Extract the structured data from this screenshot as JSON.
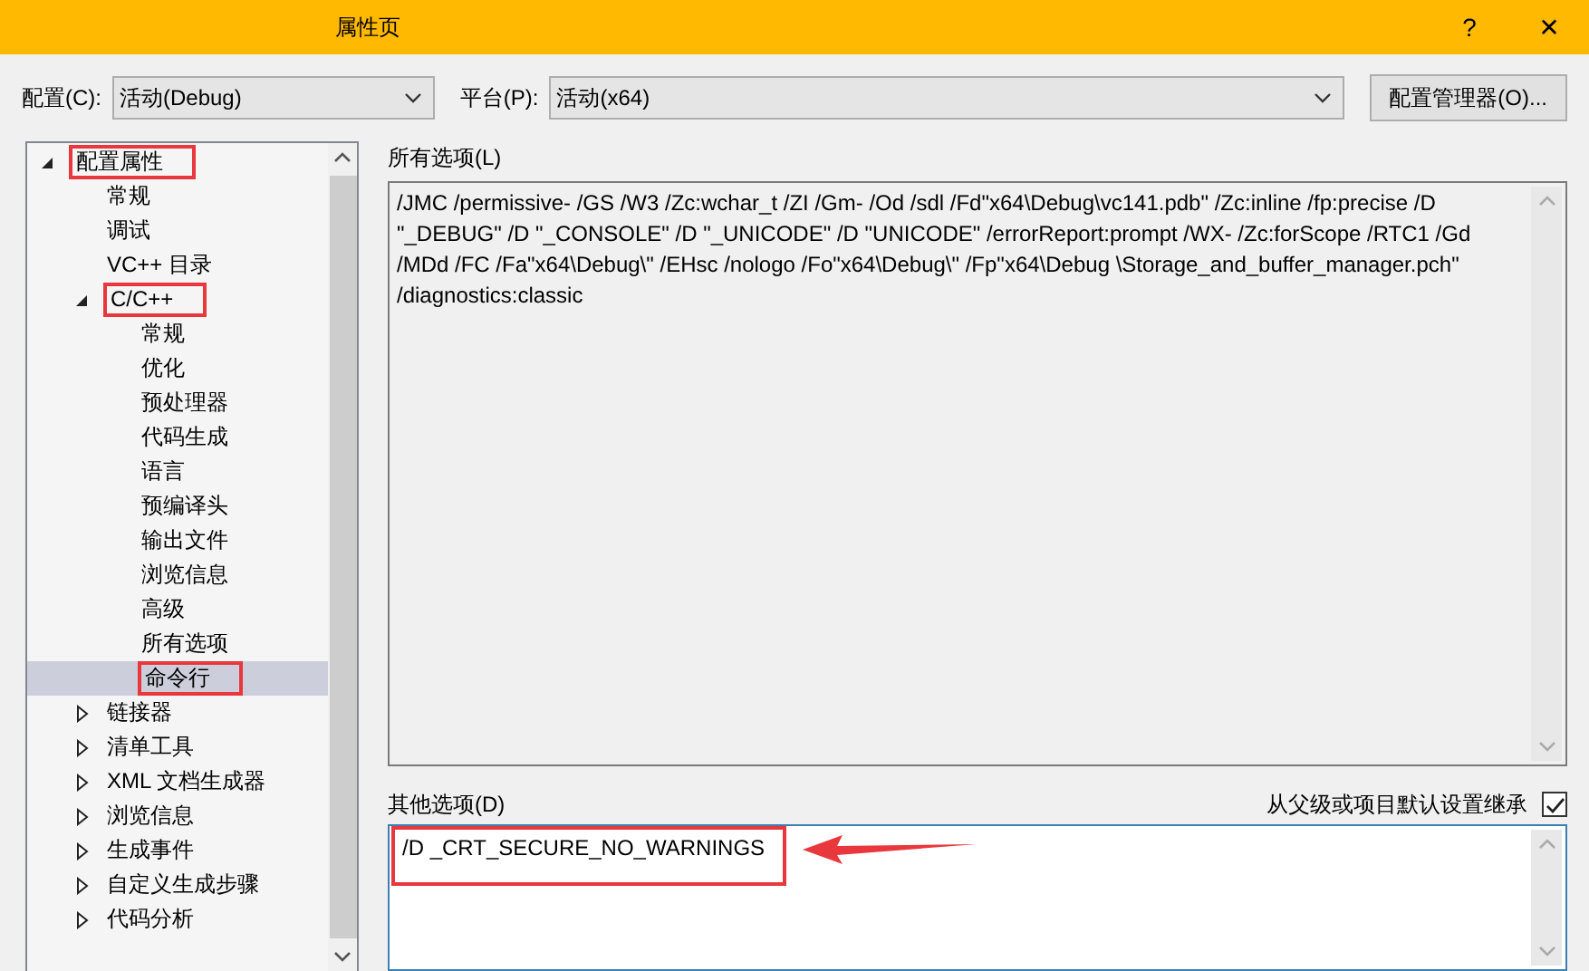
{
  "window": {
    "title": "属性页",
    "help": "?",
    "close": "✕"
  },
  "toolbar": {
    "config_label": "配置(C):",
    "config_value": "活动(Debug)",
    "platform_label": "平台(P):",
    "platform_value": "活动(x64)",
    "manager_button": "配置管理器(O)..."
  },
  "tree": [
    {
      "label": "配置属性",
      "expanded": true,
      "annotated": true,
      "selected": false,
      "children": [
        {
          "label": "常规",
          "selected": false,
          "annotated": false
        },
        {
          "label": "调试",
          "selected": false,
          "annotated": false
        },
        {
          "label": "VC++ 目录",
          "selected": false,
          "annotated": false
        },
        {
          "label": "C/C++",
          "expanded": true,
          "annotated": true,
          "selected": false,
          "children": [
            {
              "label": "常规",
              "selected": false,
              "annotated": false
            },
            {
              "label": "优化",
              "selected": false,
              "annotated": false
            },
            {
              "label": "预处理器",
              "selected": false,
              "annotated": false
            },
            {
              "label": "代码生成",
              "selected": false,
              "annotated": false
            },
            {
              "label": "语言",
              "selected": false,
              "annotated": false
            },
            {
              "label": "预编译头",
              "selected": false,
              "annotated": false
            },
            {
              "label": "输出文件",
              "selected": false,
              "annotated": false
            },
            {
              "label": "浏览信息",
              "selected": false,
              "annotated": false
            },
            {
              "label": "高级",
              "selected": false,
              "annotated": false
            },
            {
              "label": "所有选项",
              "selected": false,
              "annotated": false
            },
            {
              "label": "命令行",
              "selected": true,
              "annotated": true
            }
          ]
        },
        {
          "label": "链接器",
          "expanded": false,
          "selected": false,
          "annotated": false
        },
        {
          "label": "清单工具",
          "expanded": false,
          "selected": false,
          "annotated": false
        },
        {
          "label": "XML 文档生成器",
          "expanded": false,
          "selected": false,
          "annotated": false
        },
        {
          "label": "浏览信息",
          "expanded": false,
          "selected": false,
          "annotated": false
        },
        {
          "label": "生成事件",
          "expanded": false,
          "selected": false,
          "annotated": false
        },
        {
          "label": "自定义生成步骤",
          "expanded": false,
          "selected": false,
          "annotated": false
        },
        {
          "label": "代码分析",
          "expanded": false,
          "selected": false,
          "annotated": false
        }
      ]
    }
  ],
  "all_options": {
    "label": "所有选项(L)",
    "text": "/JMC /permissive- /GS /W3 /Zc:wchar_t /ZI /Gm- /Od /sdl /Fd\"x64\\Debug\\vc141.pdb\" /Zc:inline /fp:precise /D \"_DEBUG\" /D \"_CONSOLE\" /D \"_UNICODE\" /D \"UNICODE\" /errorReport:prompt /WX- /Zc:forScope /RTC1 /Gd /MDd /FC /Fa\"x64\\Debug\\\" /EHsc /nologo /Fo\"x64\\Debug\\\" /Fp\"x64\\Debug \\Storage_and_buffer_manager.pch\" /diagnostics:classic"
  },
  "inherit": {
    "label": "从父级或项目默认设置继承",
    "checked": true
  },
  "other_options": {
    "label": "其他选项(D)",
    "value": "/D _CRT_SECURE_NO_WARNINGS",
    "annotated": true,
    "arrow": true
  }
}
